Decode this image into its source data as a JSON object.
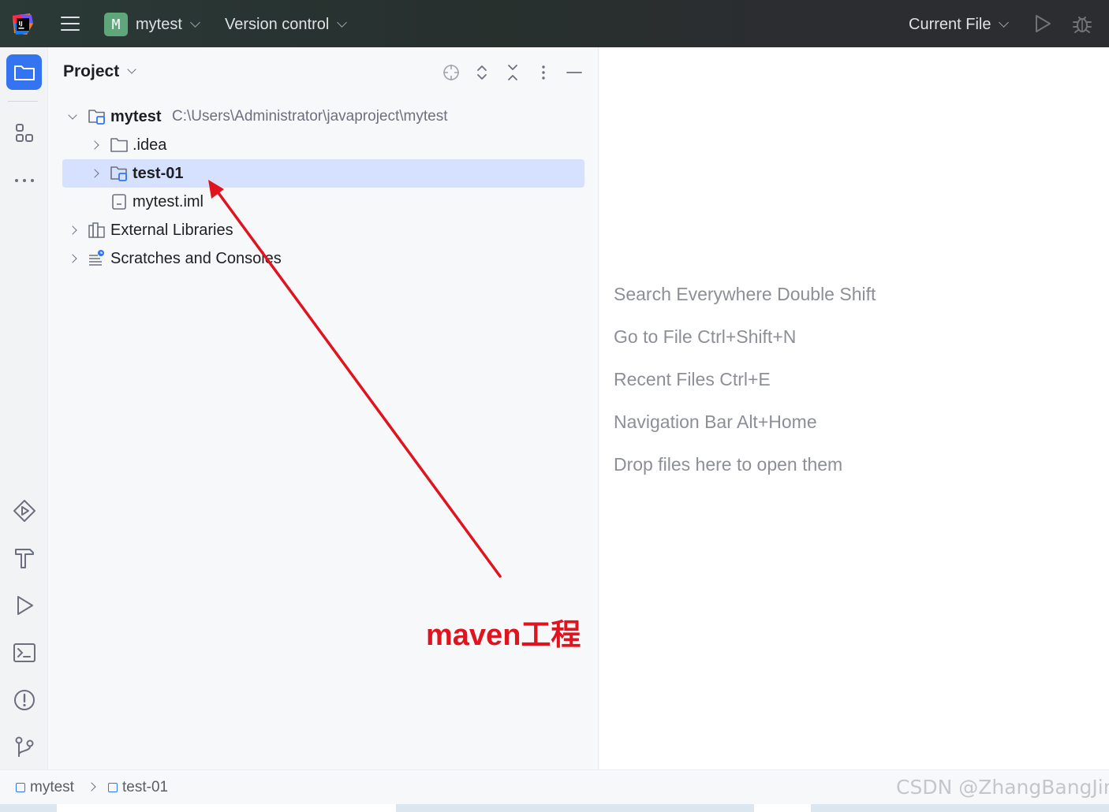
{
  "titlebar": {
    "project_badge": "M",
    "project_name": "mytest",
    "vcs_label": "Version control",
    "run_config_label": "Current File",
    "icons": [
      "intellij-logo-icon",
      "hamburger-menu-icon",
      "run-icon",
      "debug-icon"
    ]
  },
  "left_toolbar": {
    "top_items": [
      "project-folder-icon",
      "structure-icon",
      "more-icon"
    ],
    "bottom_items": [
      "services-icon",
      "build-icon",
      "run-icon",
      "terminal-icon",
      "problems-icon",
      "git-icon"
    ]
  },
  "project_panel": {
    "title": "Project",
    "header_icons": [
      "locate-icon",
      "expand-all-icon",
      "collapse-all-icon",
      "options-icon",
      "hide-icon"
    ],
    "tree": [
      {
        "label": "mytest",
        "path": "C:\\Users\\Administrator\\javaproject\\mytest",
        "icon": "module-folder-icon",
        "expanded": true,
        "level": 0
      },
      {
        "label": ".idea",
        "icon": "folder-icon",
        "expanded": false,
        "level": 1
      },
      {
        "label": "test-01",
        "icon": "module-folder-icon",
        "expanded": false,
        "level": 1,
        "selected": true
      },
      {
        "label": "mytest.iml",
        "icon": "file-icon",
        "level": 1
      },
      {
        "label": "External Libraries",
        "icon": "library-icon",
        "expanded": false,
        "level": 0
      },
      {
        "label": "Scratches and Consoles",
        "icon": "scratches-icon",
        "expanded": false,
        "level": 0
      }
    ]
  },
  "editor": {
    "hints": [
      "Search Everywhere Double Shift",
      "Go to File Ctrl+Shift+N",
      "Recent Files Ctrl+E",
      "Navigation Bar Alt+Home",
      "Drop files here to open them"
    ]
  },
  "annotation": {
    "text": "maven工程",
    "color": "#e0141e"
  },
  "statusbar": {
    "breadcrumbs": [
      "mytest",
      "test-01"
    ]
  },
  "watermark": "CSDN @ZhangBangJin",
  "colors": {
    "accent": "#3574f0",
    "selection": "#d5e1ff",
    "badge": "#5fa67a",
    "annotation": "#e0141e"
  }
}
